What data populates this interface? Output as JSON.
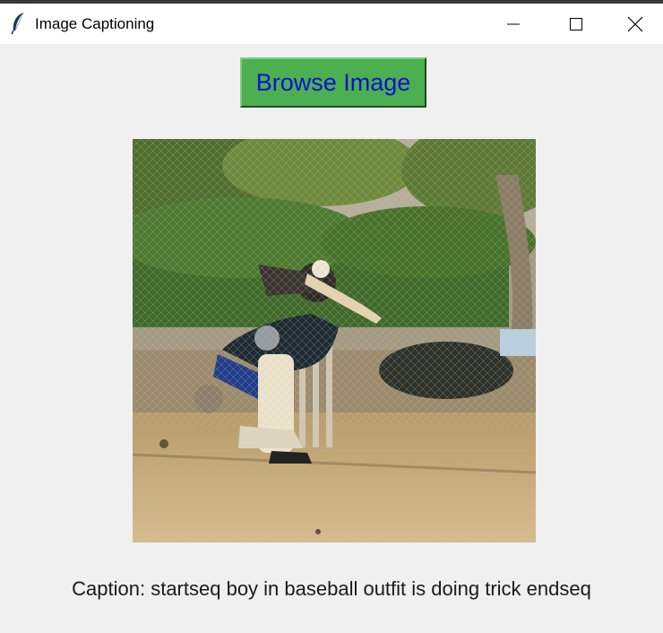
{
  "window": {
    "title": "Image Captioning",
    "icon": "feather-icon",
    "controls": [
      "minimize-icon",
      "maximize-icon",
      "close-icon"
    ]
  },
  "main": {
    "browse_button_label": "Browse Image",
    "image_content": "cricket-batsman-at-practice-nets",
    "caption_text": "Caption: startseq boy in baseball outfit is doing trick endseq"
  },
  "colors": {
    "window_background": "#f0f0f0",
    "button_background": "#4caf50",
    "button_text": "#1010d0",
    "caption_text": "#1a1a1a"
  }
}
